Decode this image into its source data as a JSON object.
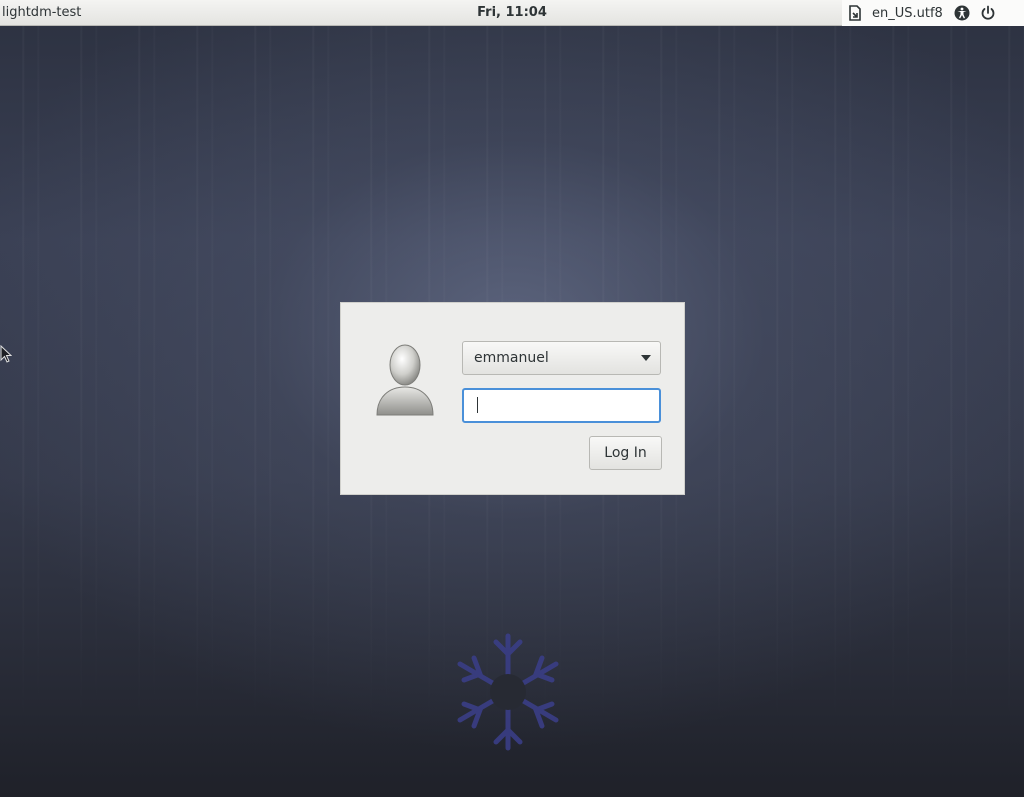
{
  "panel": {
    "title": "lightdm-test",
    "clock": "Fri, 11:04",
    "language": "en_US.utf8",
    "icons": [
      "session-icon",
      "accessibility-icon",
      "power-icon"
    ]
  },
  "login": {
    "user_selected": "emmanuel",
    "password_value": "",
    "login_label": "Log In"
  },
  "colors": {
    "focus_border": "#4a90d9",
    "logo": "#3b3f8a",
    "panel_bg": "#e9e9e6"
  }
}
